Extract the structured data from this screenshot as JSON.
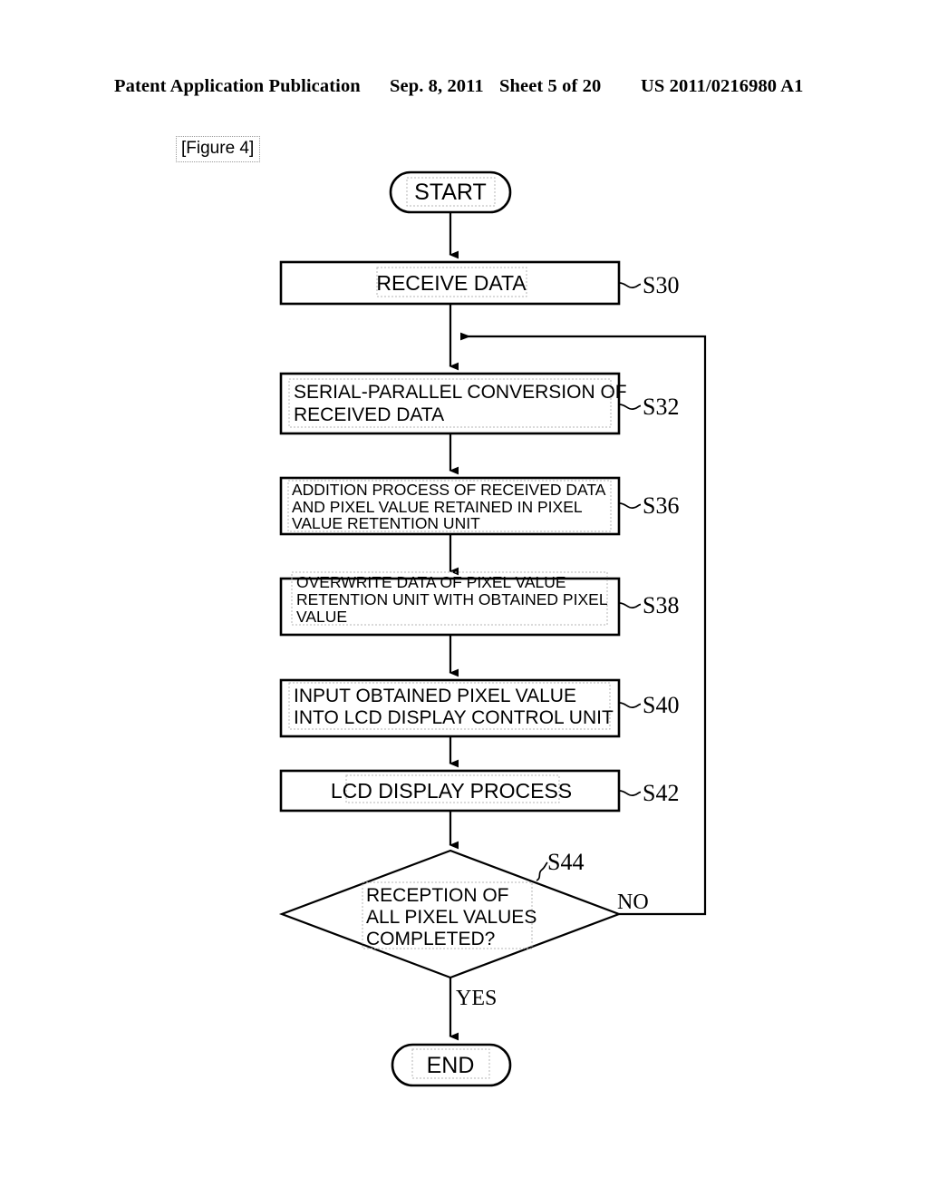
{
  "header": {
    "publication": "Patent Application Publication",
    "date": "Sep. 8, 2011",
    "sheet": "Sheet 5 of 20",
    "patent_number": "US 2011/0216980 A1"
  },
  "figure": {
    "label": "[Figure 4]"
  },
  "flowchart": {
    "start_label": "START",
    "end_label": "END",
    "branch_no": "NO",
    "branch_yes": "YES",
    "steps": [
      {
        "id": "S30",
        "shape": "process",
        "step_label": "S30",
        "lines": [
          "RECEIVE DATA"
        ]
      },
      {
        "id": "S32",
        "shape": "process",
        "step_label": "S32",
        "lines": [
          "SERIAL-PARALLEL CONVERSION OF",
          "RECEIVED DATA"
        ]
      },
      {
        "id": "S36",
        "shape": "process",
        "step_label": "S36",
        "lines": [
          "ADDITION PROCESS OF RECEIVED DATA",
          "AND PIXEL VALUE RETAINED IN PIXEL",
          "VALUE RETENTION UNIT"
        ]
      },
      {
        "id": "S38",
        "shape": "process",
        "step_label": "S38",
        "lines": [
          "OVERWRITE DATA OF PIXEL VALUE",
          "RETENTION UNIT WITH OBTAINED PIXEL",
          "VALUE"
        ]
      },
      {
        "id": "S40",
        "shape": "process",
        "step_label": "S40",
        "lines": [
          "INPUT OBTAINED PIXEL VALUE",
          "INTO LCD DISPLAY CONTROL UNIT"
        ]
      },
      {
        "id": "S42",
        "shape": "process",
        "step_label": "S42",
        "lines": [
          "LCD DISPLAY PROCESS"
        ]
      },
      {
        "id": "S44",
        "shape": "decision",
        "step_label": "S44",
        "lines": [
          "RECEPTION OF",
          "ALL PIXEL VALUES",
          "COMPLETED?"
        ]
      }
    ]
  },
  "colors": {
    "ink": "#000000",
    "paper": "#ffffff",
    "text_frame": "#b5b5b5"
  }
}
